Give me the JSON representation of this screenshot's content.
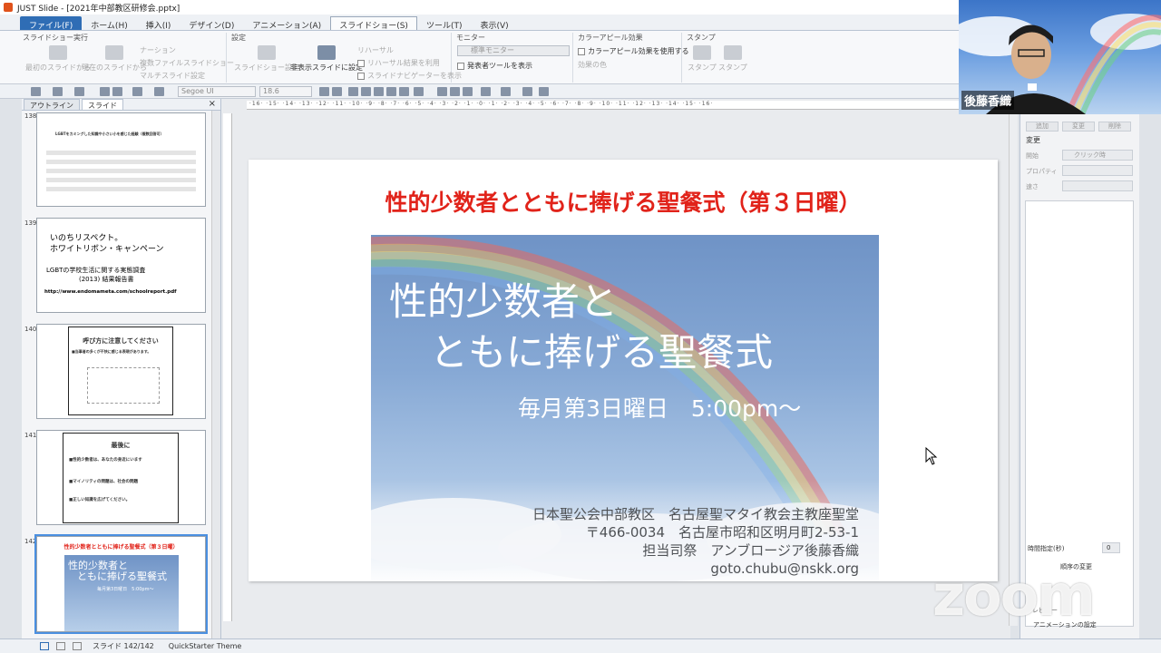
{
  "window": {
    "title": "JUST Slide - [2021年中部教区研修会.pptx]"
  },
  "menu": {
    "tabs": [
      "ファイル(F)",
      "ホーム(H)",
      "挿入(I)",
      "デザイン(D)",
      "アニメーション(A)",
      "スライドショー(S)",
      "ツール(T)",
      "表示(V)"
    ]
  },
  "ribbon": {
    "group1_title": "スライドショー実行",
    "btn_from_start": "最初のスライドから",
    "btn_from_current": "現在のスライドから",
    "opt_narration": "ナーション",
    "opt_file_slideshow": "複数ファイルスライドショー",
    "opt_multi_slide": "マルチスライド設定",
    "group2_title": "設定",
    "btn_setup": "スライドショー設定",
    "btn_hide": "非表示スライドに設定",
    "opt_rehearse": "リハーサル",
    "opt_use_rehearse": "リハーサル結果を利用",
    "opt_narrator": "スライドナビゲーターを表示",
    "group3_title": "モニター",
    "monitor_combo": "標準モニター",
    "opt_presenter": "発表者ツールを表示",
    "group4_title": "カラーアピール効果",
    "opt_color_appeal": "カラーアピール効果を使用する",
    "opt_effect_color": "効果の色",
    "group5_title": "スタンプ",
    "btn_stamp1": "スタンプ",
    "btn_stamp2": "スタンプ"
  },
  "toolbar": {
    "font_name": "Segoe UI",
    "font_size": "18.6"
  },
  "left_panel": {
    "tabs": [
      "アウトライン",
      "スライド"
    ],
    "close": "×",
    "slides": [
      {
        "num": "138",
        "title": "LGBTをカミングした知識や小さい小を感じた経験（複数回答可）"
      },
      {
        "num": "139",
        "line1": "いのちリスペクト。",
        "line2": "ホワイトリボン・キャンペーン",
        "line3": "LGBTの学校生活に関する実態調査",
        "line4": "(2013) 結果報告書",
        "link": "http://www.endomameta.com/schoolreport.pdf"
      },
      {
        "num": "140",
        "title": "呼び方に注意してください",
        "bullet": "■当事者の多くが不快に感じる表現があります。"
      },
      {
        "num": "141",
        "title": "最後に",
        "b1": "■性的少数者は、あなたの身近にいます",
        "b2": "■マイノリティの問題は、社会の問題",
        "b3": "■正しい知識を広げてください。"
      },
      {
        "num": "142",
        "title": "性的少数者とともに捧げる聖餐式（第３日曜）",
        "l1": "性的少数者と",
        "l2": "ともに捧げる聖餐式",
        "l3": "毎月第3日曜日　5:00pm〜"
      }
    ]
  },
  "slide": {
    "title": "性的少数者とともに捧げる聖餐式（第３日曜）",
    "photo_line1": "性的少数者と",
    "photo_line2": "ともに捧げる聖餐式",
    "photo_sub": "毎月第3日曜日　5:00pm〜",
    "info1": "日本聖公会中部教区　名古屋聖マタイ教会主教座聖堂",
    "info2": "〒466-0034　名古屋市昭和区明月町2-53-1",
    "info3": "担当司祭　アンブロージア後藤香織",
    "info4": "goto.chubu@nskk.org"
  },
  "right_panel": {
    "btn_add": "追加",
    "btn_change": "変更",
    "btn_delete": "削除",
    "section": "変更",
    "label_start": "開始",
    "start_value": "クリック時",
    "label_property": "プロパティ",
    "label_speed": "速さ",
    "timing_label": "時間指定(秒)",
    "timing_value": "0",
    "order_label": "順序の変更",
    "preview": "プレビュー",
    "anim_settings": "アニメーションの設定"
  },
  "status": {
    "slide": "スライド 142/142",
    "theme": "QuickStarter Theme"
  },
  "video": {
    "name": "後藤香織"
  },
  "zoom_watermark": "zoom",
  "colors": {
    "title_red": "#e1231a",
    "accent_blue": "#2f6db5"
  }
}
